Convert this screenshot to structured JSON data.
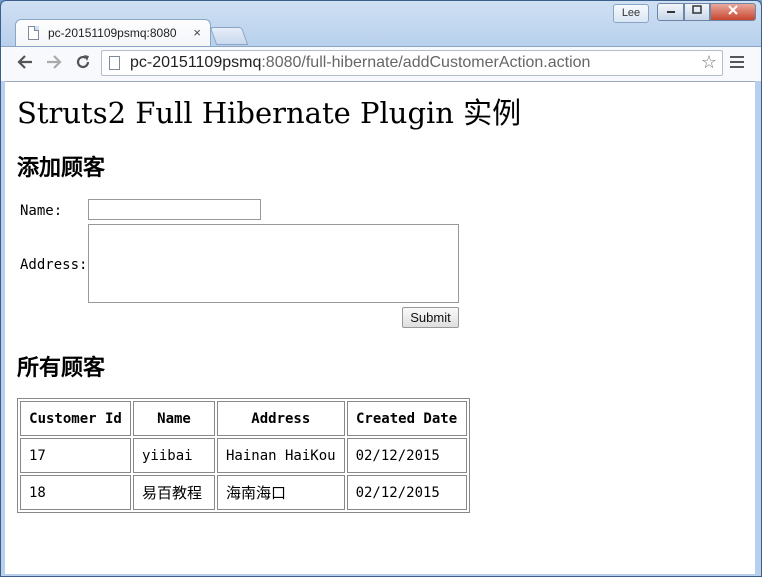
{
  "browser": {
    "tab_title": "pc-20151109psmq:8080",
    "tab_close": "×",
    "profile_name": "Lee",
    "url_host": "pc-20151109psmq",
    "url_rest": ":8080/full-hibernate/addCustomerAction.action",
    "icons": {
      "back": "back-arrow-icon",
      "forward": "forward-arrow-icon",
      "reload": "reload-icon",
      "star": "star-icon",
      "menu": "menu-icon"
    }
  },
  "page": {
    "title": "Struts2 Full Hibernate Plugin",
    "title_suffix": " 实例",
    "form_heading": "添加顾客",
    "name_label": "Name:",
    "name_value": "",
    "address_label": "Address:",
    "address_value": "",
    "submit_label": "Submit",
    "list_heading": "所有顾客"
  },
  "table": {
    "headers": [
      "Customer Id",
      "Name",
      "Address",
      "Created Date"
    ],
    "rows": [
      [
        "17",
        "yiibai",
        "Hainan HaiKou",
        "02/12/2015"
      ],
      [
        "18",
        "易百教程",
        "海南海口",
        "02/12/2015"
      ]
    ]
  }
}
